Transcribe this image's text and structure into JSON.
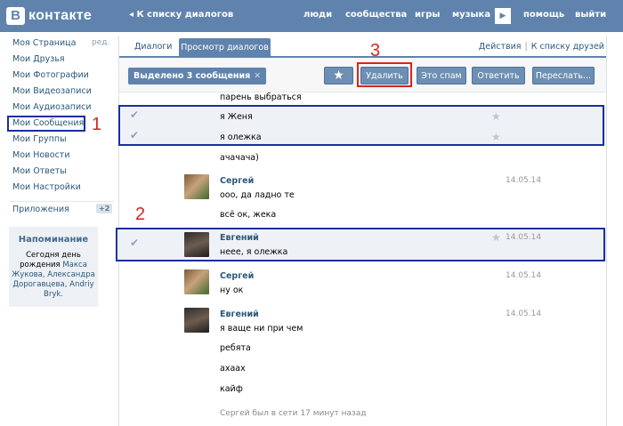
{
  "header": {
    "logo_letter": "В",
    "logo_text": "контакте",
    "back_link": "◂ К списку диалогов",
    "nav": [
      "люди",
      "сообщества",
      "игры",
      "музыка",
      "помощь",
      "выйти"
    ]
  },
  "sidebar": {
    "items": [
      {
        "label": "Моя Страница"
      },
      {
        "label": "Мои Друзья"
      },
      {
        "label": "Мои Фотографии"
      },
      {
        "label": "Мои Видеозаписи"
      },
      {
        "label": "Мои Аудиозаписи"
      },
      {
        "label": "Мои Сообщения"
      },
      {
        "label": "Мои Группы"
      },
      {
        "label": "Мои Новости"
      },
      {
        "label": "Мои Ответы"
      },
      {
        "label": "Мои Настройки"
      }
    ],
    "edit_label": "ред.",
    "apps_label": "Приложения",
    "apps_badge": "+2",
    "reminder": {
      "title": "Напоминание",
      "line1": "Сегодня день",
      "line2": "рождения",
      "name1": "Макса Жукова,",
      "name2": "Александра Дорогавцева,",
      "name3": "Andriy Bryk."
    }
  },
  "annotations": {
    "one": "1",
    "two": "2",
    "three": "3"
  },
  "tabs": {
    "dialogs": "Диалоги",
    "view": "Просмотр диалогов",
    "actions": "Действия",
    "friends": "К списку друзей"
  },
  "toolbar": {
    "selected": "Выделено 3 сообщения",
    "close_x": "✕",
    "star": "★",
    "delete": "Удалить",
    "spam": "Это спам",
    "reply": "Ответить",
    "forward": "Переслать..."
  },
  "messages": {
    "m0": "парень выбраться",
    "m1": "я Женя",
    "m2": "я олежка",
    "m3": "ачачача)",
    "sergey": "Сергей",
    "date": "14.05.14",
    "m4": "ооо, да ладно те",
    "m5": "всё ок, жека",
    "evgeniy": "Евгений",
    "m6": "неее, я олежка",
    "m7": "ну ок",
    "m8": "я ваще ни при чем",
    "m9": "ребята",
    "m10": "ахаах",
    "m11": "кайф"
  },
  "status": "Сергей был в сети 17 минут назад",
  "colors": {
    "header": "#5f83ad",
    "link": "#2b587a",
    "annotation": "#d62424",
    "frame": "#1a2ea0"
  }
}
